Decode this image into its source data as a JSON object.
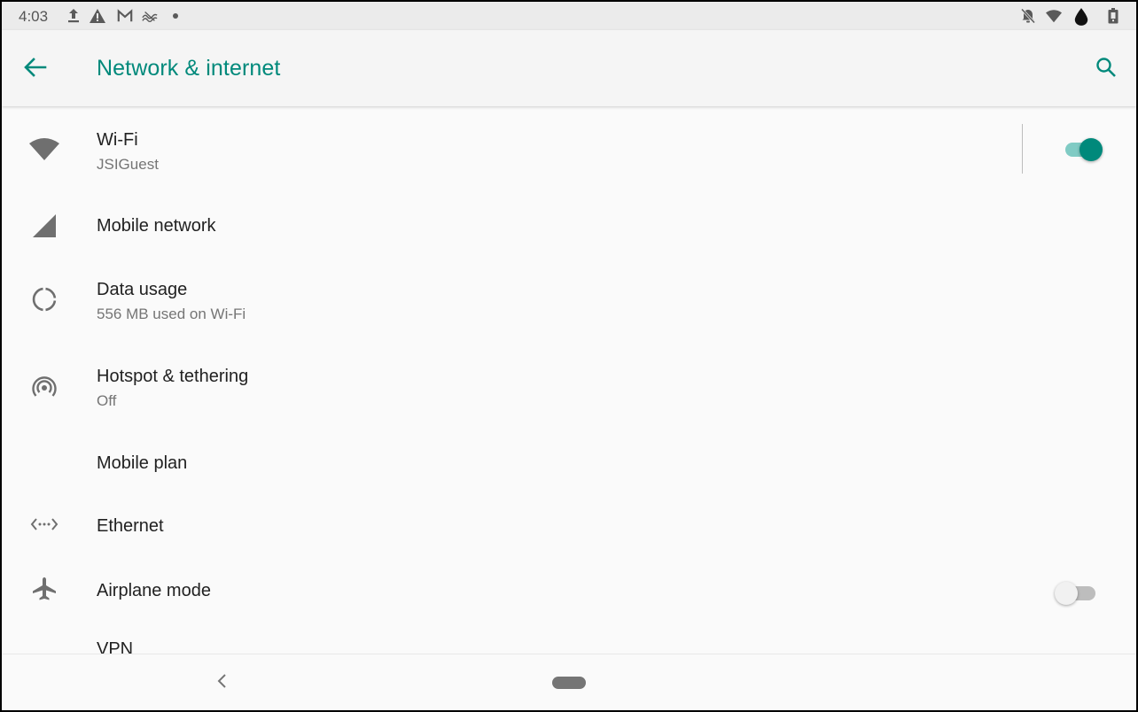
{
  "status_bar": {
    "time": "4:03",
    "left_icons": [
      "upload-icon",
      "warning-icon",
      "gmail-icon",
      "no-signal-icon",
      "dot-icon"
    ],
    "right_icons": [
      "notifications-off-icon",
      "wifi-icon",
      "water-drop-icon",
      "battery-icon"
    ]
  },
  "app_bar": {
    "title": "Network & internet",
    "back_icon": "arrow-back-icon",
    "search_icon": "search-icon",
    "accent_color": "#00897b"
  },
  "items": [
    {
      "label": "Wi-Fi",
      "subtitle": "JSIGuest",
      "icon": "wifi-icon",
      "toggle": true
    },
    {
      "label": "Mobile network",
      "icon": "cell-signal-icon"
    },
    {
      "label": "Data usage",
      "subtitle": "556 MB used on Wi-Fi",
      "icon": "data-usage-icon"
    },
    {
      "label": "Hotspot & tethering",
      "subtitle": "Off",
      "icon": "hotspot-icon"
    },
    {
      "label": "Mobile plan"
    },
    {
      "label": "Ethernet",
      "icon": "ethernet-icon"
    },
    {
      "label": "Airplane mode",
      "icon": "airplane-icon",
      "toggle": false
    },
    {
      "label": "VPN"
    }
  ],
  "nav_bar": {
    "back_icon": "nav-back-icon",
    "home_icon": "home-pill-icon"
  }
}
